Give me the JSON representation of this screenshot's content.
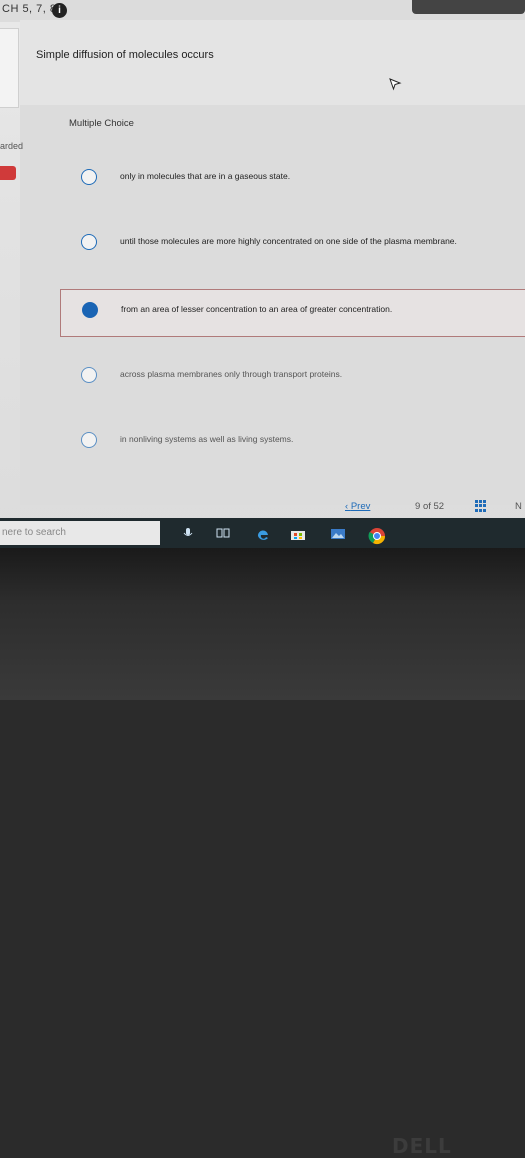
{
  "header": {
    "chapter_label": "CH 5, 7, 8",
    "info_icon": "i"
  },
  "question": {
    "text": "Simple diffusion of molecules occurs",
    "type": "Multiple Choice"
  },
  "left_panel": {
    "label": "arded",
    "badge": ""
  },
  "options": [
    {
      "text": "only in molecules that are in a gaseous state.",
      "selected": false
    },
    {
      "text": "until those molecules are more highly concentrated on one side of the plasma membrane.",
      "selected": false
    },
    {
      "text": "from an area of lesser concentration to an area of greater concentration.",
      "selected": true
    },
    {
      "text": "across plasma membranes only through transport proteins.",
      "selected": false
    },
    {
      "text": "in nonliving systems as well as living systems.",
      "selected": false
    }
  ],
  "pager": {
    "prev": "Prev",
    "current": "9",
    "of": "of",
    "total": "52",
    "next": "N"
  },
  "taskbar": {
    "search_placeholder": "nere to search"
  },
  "bezel": {
    "logo": "DELL"
  },
  "colors": {
    "accent": "#1e6bb8",
    "selected_border": "#b07a7a",
    "taskbar": "#1f2a2e"
  }
}
